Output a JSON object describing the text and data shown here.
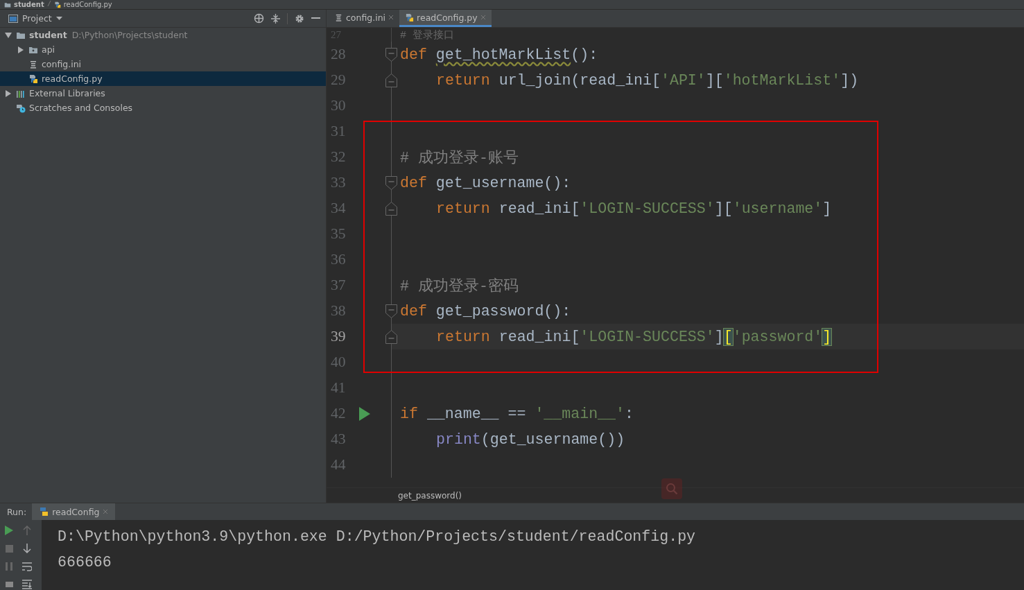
{
  "breadcrumb": [
    {
      "text": "student",
      "kind": "folder"
    },
    {
      "text": "readConfig.py",
      "kind": "python"
    }
  ],
  "project_panel": {
    "title": "Project",
    "tree": [
      {
        "name": "student",
        "path": "D:\\Python\\Projects\\student",
        "kind": "folder",
        "expanded": true,
        "selected": false,
        "children": [
          {
            "name": "api",
            "kind": "package",
            "expanded": false,
            "selected": false
          },
          {
            "name": "config.ini",
            "kind": "ini",
            "selected": false
          },
          {
            "name": "readConfig.py",
            "kind": "python",
            "selected": true
          }
        ]
      },
      {
        "name": "External Libraries",
        "kind": "libraries",
        "expanded": false,
        "selected": false
      },
      {
        "name": "Scratches and Consoles",
        "kind": "scratches",
        "selected": false
      }
    ]
  },
  "tabs": [
    {
      "label": "config.ini",
      "kind": "ini",
      "selected": false
    },
    {
      "label": "readConfig.py",
      "kind": "python",
      "selected": true
    }
  ],
  "code": {
    "lines": [
      {
        "number": "27",
        "partial": true,
        "indented": false,
        "fold_start": false,
        "fold_end": false,
        "current": false,
        "run": false,
        "tokens": [
          {
            "kind": "comment",
            "text": "# 登录接口"
          }
        ]
      },
      {
        "number": "28",
        "partial": false,
        "indented": false,
        "fold_start": true,
        "fold_end": false,
        "current": false,
        "run": false,
        "tokens": [
          {
            "kind": "keyword",
            "text": "def "
          },
          {
            "kind": "typo",
            "text": "get_hotMarkList"
          },
          {
            "kind": "plain",
            "text": "():"
          }
        ]
      },
      {
        "number": "29",
        "partial": false,
        "indented": true,
        "fold_start": false,
        "fold_end": true,
        "current": false,
        "run": false,
        "tokens": [
          {
            "kind": "keyword",
            "text": "return "
          },
          {
            "kind": "plain",
            "text": "url_join(read_ini["
          },
          {
            "kind": "string",
            "text": "'API'"
          },
          {
            "kind": "plain",
            "text": "]["
          },
          {
            "kind": "string",
            "text": "'hotMarkList'"
          },
          {
            "kind": "plain",
            "text": "])"
          }
        ]
      },
      {
        "number": "30",
        "partial": false,
        "fold_start": false,
        "fold_end": false,
        "current": false,
        "run": false
      },
      {
        "number": "31",
        "partial": false,
        "fold_start": false,
        "fold_end": false,
        "current": false,
        "run": false
      },
      {
        "number": "32",
        "partial": false,
        "indented": false,
        "fold_start": false,
        "fold_end": false,
        "current": false,
        "run": false,
        "tokens": [
          {
            "kind": "comment",
            "text": "# 成功登录-账号"
          }
        ]
      },
      {
        "number": "33",
        "partial": false,
        "indented": false,
        "fold_start": true,
        "fold_end": false,
        "current": false,
        "run": false,
        "tokens": [
          {
            "kind": "keyword",
            "text": "def "
          },
          {
            "kind": "plain",
            "text": "get_username():"
          }
        ]
      },
      {
        "number": "34",
        "partial": false,
        "indented": true,
        "fold_start": false,
        "fold_end": true,
        "current": false,
        "run": false,
        "tokens": [
          {
            "kind": "keyword",
            "text": "return "
          },
          {
            "kind": "plain",
            "text": "read_ini["
          },
          {
            "kind": "string",
            "text": "'LOGIN-SUCCESS'"
          },
          {
            "kind": "plain",
            "text": "]["
          },
          {
            "kind": "string",
            "text": "'username'"
          },
          {
            "kind": "plain",
            "text": "]"
          }
        ]
      },
      {
        "number": "35",
        "partial": false,
        "fold_start": false,
        "fold_end": false,
        "current": false,
        "run": false
      },
      {
        "number": "36",
        "partial": false,
        "fold_start": false,
        "fold_end": false,
        "current": false,
        "run": false
      },
      {
        "number": "37",
        "partial": false,
        "indented": false,
        "fold_start": false,
        "fold_end": false,
        "current": false,
        "run": false,
        "tokens": [
          {
            "kind": "comment",
            "text": "# 成功登录-密码"
          }
        ]
      },
      {
        "number": "38",
        "partial": false,
        "indented": false,
        "fold_start": true,
        "fold_end": false,
        "current": false,
        "run": false,
        "tokens": [
          {
            "kind": "keyword",
            "text": "def "
          },
          {
            "kind": "plain",
            "text": "get_password():"
          }
        ]
      },
      {
        "number": "39",
        "partial": false,
        "indented": true,
        "fold_start": false,
        "fold_end": true,
        "current": true,
        "run": false,
        "tokens": [
          {
            "kind": "keyword",
            "text": "return "
          },
          {
            "kind": "plain",
            "text": "read_ini["
          },
          {
            "kind": "string",
            "text": "'LOGIN-SUCCESS'"
          },
          {
            "kind": "plain",
            "text": "]"
          },
          {
            "kind": "match",
            "text": "["
          },
          {
            "kind": "string",
            "text": "'password'"
          },
          {
            "kind": "match",
            "text": "]"
          }
        ]
      },
      {
        "number": "40",
        "partial": false,
        "fold_start": false,
        "fold_end": false,
        "current": false,
        "run": false
      },
      {
        "number": "41",
        "partial": false,
        "fold_start": false,
        "fold_end": false,
        "current": false,
        "run": false
      },
      {
        "number": "42",
        "partial": false,
        "indented": false,
        "fold_start": false,
        "fold_end": false,
        "current": false,
        "run": true,
        "tokens": [
          {
            "kind": "keyword",
            "text": "if "
          },
          {
            "kind": "plain",
            "text": "__name__ == "
          },
          {
            "kind": "string",
            "text": "'__main__'"
          },
          {
            "kind": "plain",
            "text": ":"
          }
        ]
      },
      {
        "number": "43",
        "partial": false,
        "indented": true,
        "fold_start": false,
        "fold_end": false,
        "current": false,
        "run": false,
        "tokens": [
          {
            "kind": "builtin",
            "text": "print"
          },
          {
            "kind": "plain",
            "text": "(get_username())"
          }
        ]
      },
      {
        "number": "44",
        "partial": false,
        "fold_start": false,
        "fold_end": false,
        "current": false,
        "run": false
      }
    ],
    "footer": "get_password()"
  },
  "run_panel": {
    "label": "Run:",
    "tab": "readConfig",
    "output": [
      "D:\\Python\\python3.9\\python.exe D:/Python/Projects/student/readConfig.py",
      "666666"
    ]
  }
}
